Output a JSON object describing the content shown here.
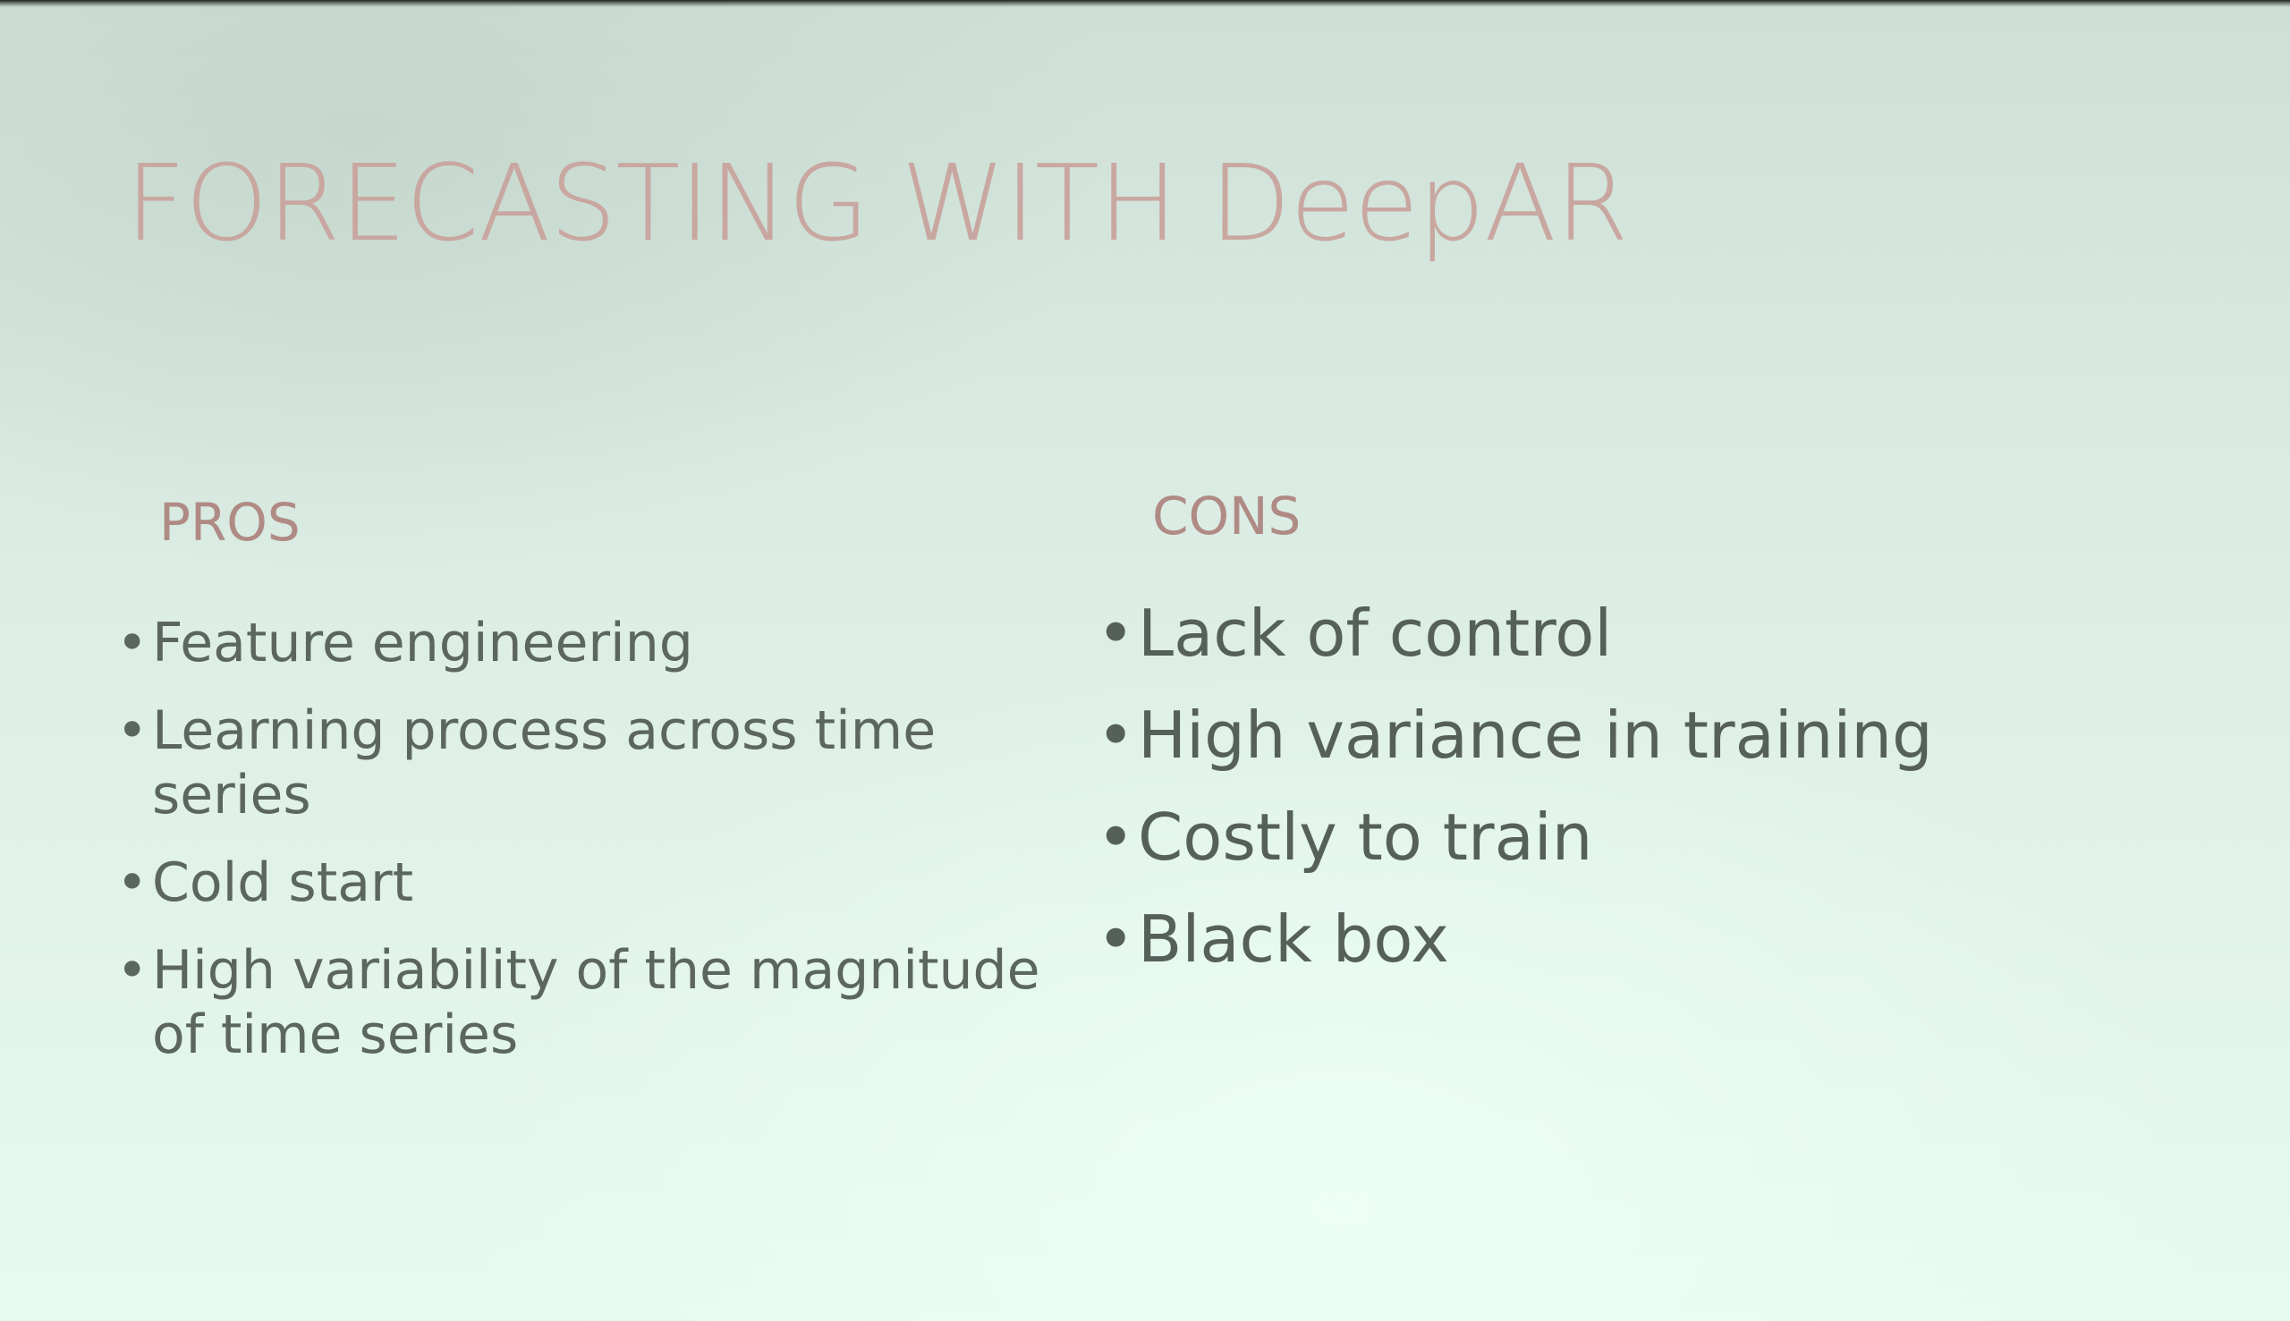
{
  "slide": {
    "title": "FORECASTING WITH DeepAR",
    "bullet_char": "•",
    "colors": {
      "title": "#c9a7a1",
      "heading": "#b08a84",
      "body_text": "#5c6660",
      "background": "#dfeee6"
    },
    "pros": {
      "heading": "PROS",
      "items": [
        {
          "lines": [
            "Feature engineering"
          ]
        },
        {
          "lines": [
            "Learning process across time",
            "series"
          ]
        },
        {
          "lines": [
            "Cold start"
          ]
        },
        {
          "lines": [
            "High variability of the magnitude",
            "of time series"
          ]
        }
      ]
    },
    "cons": {
      "heading": "CONS",
      "items": [
        {
          "lines": [
            "Lack of control"
          ]
        },
        {
          "lines": [
            "High variance in training"
          ]
        },
        {
          "lines": [
            "Costly to train"
          ]
        },
        {
          "lines": [
            "Black box"
          ]
        }
      ]
    }
  }
}
